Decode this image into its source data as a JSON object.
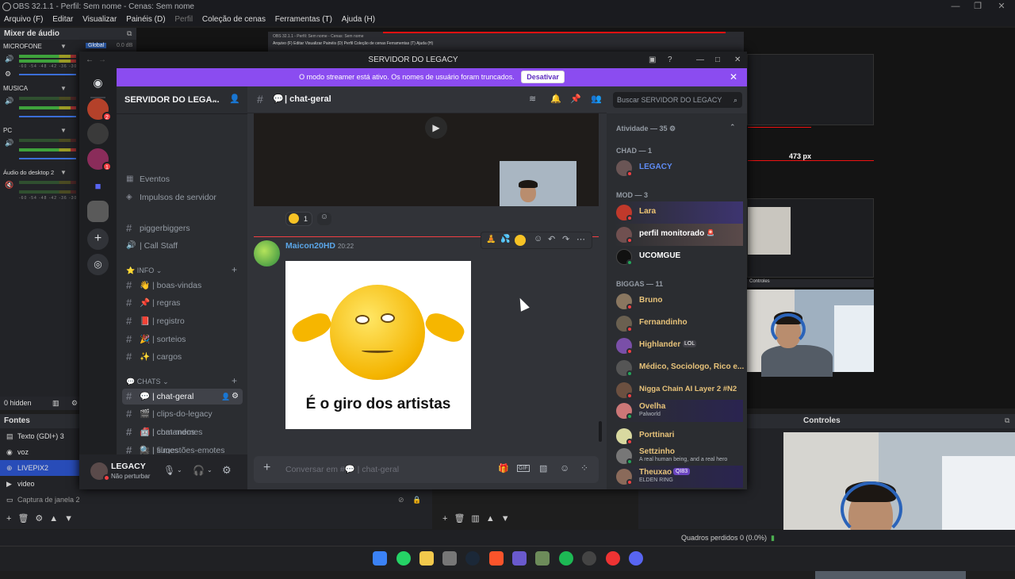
{
  "obs": {
    "title": "OBS 32.1.1 - Perfil: Sem nome - Cenas: Sem nome",
    "menu": [
      "Arquivo (F)",
      "Editar",
      "Visualizar",
      "Painéis (D)",
      "Perfil",
      "Coleção de cenas",
      "Ferramentas (T)",
      "Ajuda (H)"
    ],
    "mixer_title": "Mixer de áudio",
    "global_label": "Global",
    "global_value": "0.0 dB",
    "tracks": [
      {
        "name": "MICROFONE"
      },
      {
        "name": "MUSICA"
      },
      {
        "name": "PC"
      },
      {
        "name": "Áudio do desktop 2"
      }
    ],
    "meter_scale": "-60 -54 -48 -42 -36 -30 -24",
    "hidden_label": "0 hidden",
    "sources_title": "Fontes",
    "sources": [
      {
        "label": "Texto (GDI+) 3",
        "icon": "text-icon"
      },
      {
        "label": "voz",
        "icon": "mic-icon"
      },
      {
        "label": "LIVEPIX2",
        "icon": "globe-icon",
        "selected": true
      },
      {
        "label": "video",
        "icon": "video-icon"
      },
      {
        "label": "Captura de janela 2",
        "icon": "window-icon",
        "dim": true
      }
    ],
    "controls_title": "Controles",
    "mini_controls_label": "Controles",
    "measure_label": "473 px",
    "status_dropped": "Quadros perdidos 0 (0.0%)",
    "mini_title": "OBS 32.1.1 - Perfil: Sem nome - Cenas: Sem nome",
    "mini_menu": "Arquivo (F)   Editar   Visualizar   Painéis (D)   Perfil   Coleção de cenas   Ferramentas (T)   Ajuda (H)"
  },
  "discord": {
    "window_title": "SERVIDOR DO LEGACY",
    "banner_text": "O modo streamer está ativo. Os nomes de usuário foram truncados.",
    "banner_button": "Desativar",
    "server_name": "SERVIDOR DO LEGA...",
    "top_items": [
      {
        "label": "Eventos",
        "icon": "calendar-icon"
      },
      {
        "label": "Impulsos de servidor",
        "icon": "boost-icon"
      }
    ],
    "channels_top": [
      {
        "label": "piggerbiggers"
      },
      {
        "label": "| Call Staff"
      }
    ],
    "cat_info": "INFO",
    "info_channels": [
      {
        "label": "| boas-vindas",
        "emoji": "👋"
      },
      {
        "label": "| regras",
        "emoji": "📌"
      },
      {
        "label": "| registro",
        "emoji": "📕"
      },
      {
        "label": "| sorteios",
        "emoji": "🎉"
      },
      {
        "label": "| cargos",
        "emoji": "✨"
      }
    ],
    "cat_chats": "CHATS",
    "chat_channels": [
      {
        "label": "| chat-geral",
        "emoji": "💬",
        "selected": true
      },
      {
        "label": "| clips-do-legacy",
        "emoji": "🎬"
      },
      {
        "label": "| chat-memes",
        "emoji": "💋"
      },
      {
        "label": "| filmes",
        "emoji": "🎥"
      },
      {
        "label": "| comandos",
        "emoji": "🤖"
      },
      {
        "label": "| sugestões-emotes",
        "emoji": "🔍"
      }
    ],
    "user_name": "LEGACY",
    "user_status": "Não perturbar",
    "channel_header": "| chat-geral",
    "search_placeholder": "Buscar SERVIDOR DO LEGACY",
    "reaction_count": "1",
    "message_author": "Maicon20HD",
    "message_time": "20:22",
    "meme_caption": "É o giro dos artistas",
    "composer_placeholder": "Conversar em #💬 | chat-geral",
    "activity_header": "Atividade — 35",
    "groups": [
      {
        "title": "CHAD — 1",
        "members": [
          {
            "name": "LEGACY",
            "color": "#5f8cf5"
          }
        ]
      },
      {
        "title": "MOD — 3",
        "members": [
          {
            "name": "Lara",
            "color": "#f0c674"
          },
          {
            "name": "perfil monitorado",
            "color": "#ffffff"
          },
          {
            "name": "UCOMGUE",
            "color": "#ffffff"
          }
        ]
      },
      {
        "title": "BIGGAS — 11",
        "members": [
          {
            "name": "Bruno",
            "color": "#e8c37a"
          },
          {
            "name": "Fernandinho",
            "color": "#e8c37a"
          },
          {
            "name": "Highlander",
            "color": "#e8c37a",
            "tag": "LOL"
          },
          {
            "name": "Médico, Sociologo, Rico e...",
            "color": "#e8c37a"
          },
          {
            "name": "Nigga Chain AI Layer 2 #N2",
            "color": "#e8c37a"
          },
          {
            "name": "Ovelha",
            "color": "#e8c37a",
            "sub": "Palworld"
          },
          {
            "name": "Porttinari",
            "color": "#e8c37a"
          },
          {
            "name": "Settzinho",
            "color": "#e8c37a",
            "sub": "A real human being, and a real hero"
          },
          {
            "name": "Theuxao",
            "color": "#e8c37a",
            "tag": "QI83",
            "sub": "ELDEN RING"
          }
        ]
      }
    ]
  }
}
